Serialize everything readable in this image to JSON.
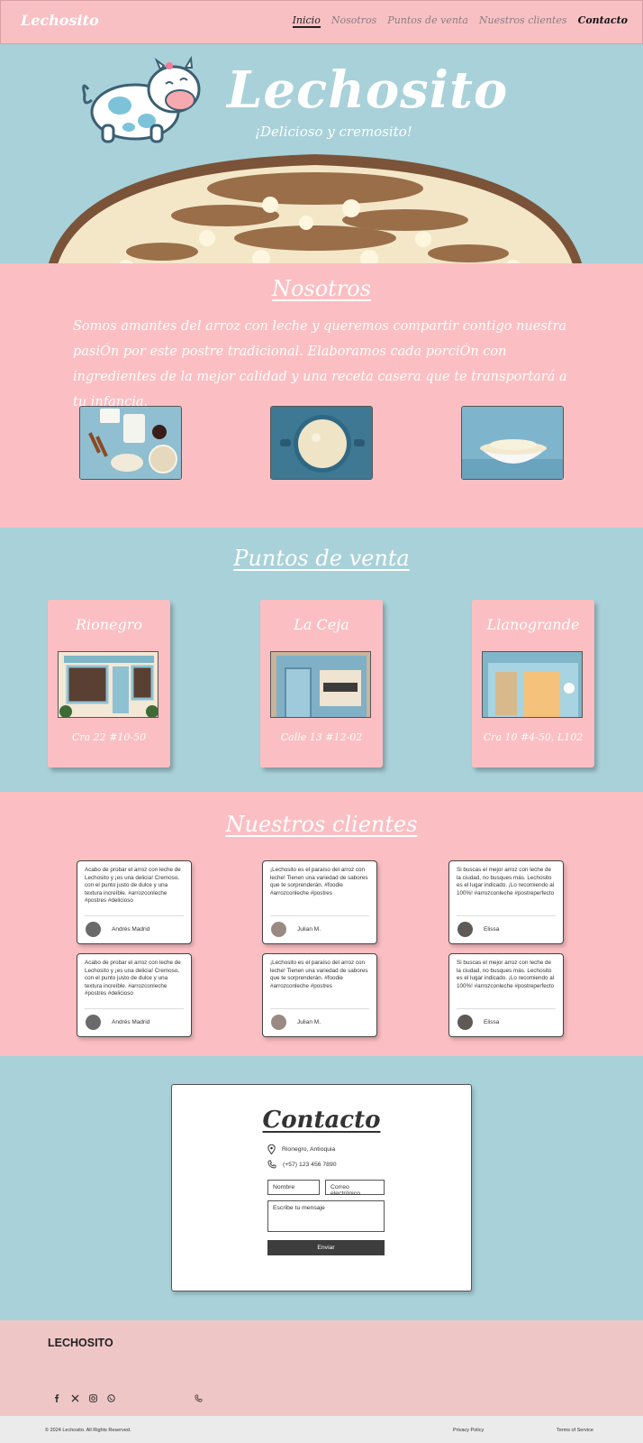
{
  "nav": {
    "brand": "Lechosito",
    "links": [
      "Inicio",
      "Nosotros",
      "Puntos de venta",
      "Nuestros clientes",
      "Contacto"
    ]
  },
  "hero": {
    "title": "Lechosito",
    "subtitle": "¡Delicioso y cremosito!"
  },
  "nosotros": {
    "title": "Nosotros",
    "text": "Somos amantes del arroz con leche y queremos compartir contigo nuestra pasiÓn por este postre tradicional. Elaboramos cada porciÓn con ingredientes de la mejor calidad y una receta casera que te transportará a tu infancia."
  },
  "puntos": {
    "title": "Puntos de venta",
    "stores": [
      {
        "name": "Rionegro",
        "address": "Cra 22 #10-50"
      },
      {
        "name": "La Ceja",
        "address": "Calle 13 #12-02"
      },
      {
        "name": "Llanogrande",
        "address": "Cra 10 #4-50, L102"
      }
    ]
  },
  "clientes": {
    "title": "Nuestros clientes",
    "reviews": [
      {
        "text": "Acabo de probar el arroz con leche de Lechosito y ¡es una delicia! Cremoso, con el punto justo de dulce y una textura increíble. #arrozconleche #postres #delicioso",
        "name": "Andrés Madrid"
      },
      {
        "text": "¡Lechosito es el paraíso del arroz con leche! Tienen una variedad de sabores que te sorprenderán. #foodie #arrozconleche #postres",
        "name": "Julian M."
      },
      {
        "text": "Si buscas el mejor arroz con leche de la ciudad, no busques más. Lechosito es el lugar indicado. ¡Lo recomiendo al 100%! #arrozconleche #postreperfecto",
        "name": "Elissa"
      },
      {
        "text": "Acabo de probar el arroz con leche de Lechosito y ¡es una delicia! Cremoso, con el punto justo de dulce y una textura increíble. #arrozconleche #postres #delicioso",
        "name": "Andrés Madrid"
      },
      {
        "text": "¡Lechosito es el paraíso del arroz con leche! Tienen una variedad de sabores que te sorprenderán. #foodie #arrozconleche #postres",
        "name": "Julian M."
      },
      {
        "text": "Si buscas el mejor arroz con leche de la ciudad, no busques más. Lechosito es el lugar indicado. ¡Lo recomiendo al 100%! #arrozconleche #postreperfecto",
        "name": "Elissa"
      }
    ]
  },
  "contacto": {
    "title": "Contacto",
    "location": "Rionegro, Antioquia",
    "phone": "(+57) 123 456 7890",
    "name_placeholder": "Nombre",
    "email_placeholder": "Correo electrónico",
    "message_placeholder": "Escribe tu mensaje",
    "send_label": "Enviar"
  },
  "footer": {
    "brand": "LECHOSITO",
    "copyright": "© 2024 Lechosito. All Rights Reserved.",
    "privacy": "Privacy Policy",
    "terms": "Terms of Service"
  },
  "colors": {
    "pink": "#fbbfc3",
    "blue": "#a9d1d9",
    "dark": "#3d3d3d"
  }
}
